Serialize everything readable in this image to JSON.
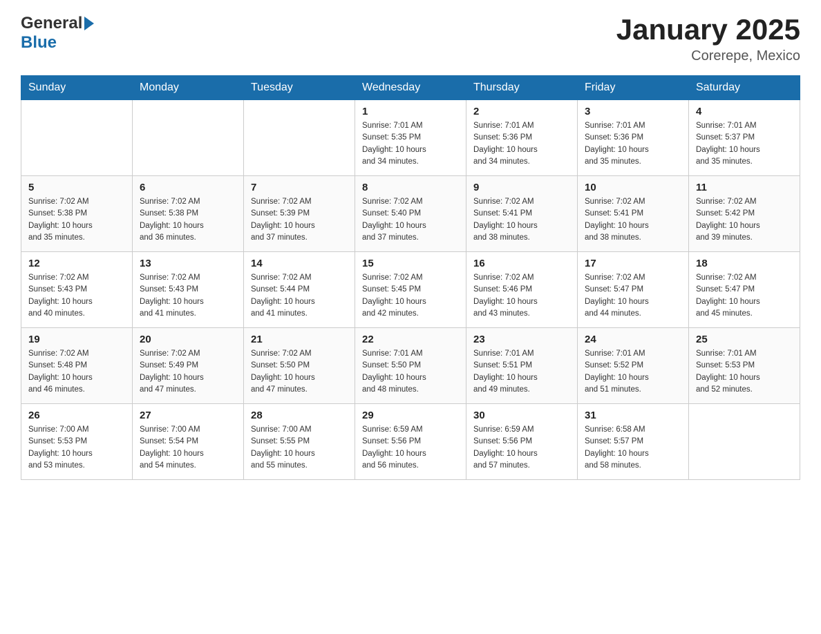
{
  "header": {
    "title": "January 2025",
    "subtitle": "Corerepe, Mexico",
    "logo_general": "General",
    "logo_blue": "Blue"
  },
  "days_of_week": [
    "Sunday",
    "Monday",
    "Tuesday",
    "Wednesday",
    "Thursday",
    "Friday",
    "Saturday"
  ],
  "weeks": [
    [
      {
        "day": "",
        "info": ""
      },
      {
        "day": "",
        "info": ""
      },
      {
        "day": "",
        "info": ""
      },
      {
        "day": "1",
        "info": "Sunrise: 7:01 AM\nSunset: 5:35 PM\nDaylight: 10 hours\nand 34 minutes."
      },
      {
        "day": "2",
        "info": "Sunrise: 7:01 AM\nSunset: 5:36 PM\nDaylight: 10 hours\nand 34 minutes."
      },
      {
        "day": "3",
        "info": "Sunrise: 7:01 AM\nSunset: 5:36 PM\nDaylight: 10 hours\nand 35 minutes."
      },
      {
        "day": "4",
        "info": "Sunrise: 7:01 AM\nSunset: 5:37 PM\nDaylight: 10 hours\nand 35 minutes."
      }
    ],
    [
      {
        "day": "5",
        "info": "Sunrise: 7:02 AM\nSunset: 5:38 PM\nDaylight: 10 hours\nand 35 minutes."
      },
      {
        "day": "6",
        "info": "Sunrise: 7:02 AM\nSunset: 5:38 PM\nDaylight: 10 hours\nand 36 minutes."
      },
      {
        "day": "7",
        "info": "Sunrise: 7:02 AM\nSunset: 5:39 PM\nDaylight: 10 hours\nand 37 minutes."
      },
      {
        "day": "8",
        "info": "Sunrise: 7:02 AM\nSunset: 5:40 PM\nDaylight: 10 hours\nand 37 minutes."
      },
      {
        "day": "9",
        "info": "Sunrise: 7:02 AM\nSunset: 5:41 PM\nDaylight: 10 hours\nand 38 minutes."
      },
      {
        "day": "10",
        "info": "Sunrise: 7:02 AM\nSunset: 5:41 PM\nDaylight: 10 hours\nand 38 minutes."
      },
      {
        "day": "11",
        "info": "Sunrise: 7:02 AM\nSunset: 5:42 PM\nDaylight: 10 hours\nand 39 minutes."
      }
    ],
    [
      {
        "day": "12",
        "info": "Sunrise: 7:02 AM\nSunset: 5:43 PM\nDaylight: 10 hours\nand 40 minutes."
      },
      {
        "day": "13",
        "info": "Sunrise: 7:02 AM\nSunset: 5:43 PM\nDaylight: 10 hours\nand 41 minutes."
      },
      {
        "day": "14",
        "info": "Sunrise: 7:02 AM\nSunset: 5:44 PM\nDaylight: 10 hours\nand 41 minutes."
      },
      {
        "day": "15",
        "info": "Sunrise: 7:02 AM\nSunset: 5:45 PM\nDaylight: 10 hours\nand 42 minutes."
      },
      {
        "day": "16",
        "info": "Sunrise: 7:02 AM\nSunset: 5:46 PM\nDaylight: 10 hours\nand 43 minutes."
      },
      {
        "day": "17",
        "info": "Sunrise: 7:02 AM\nSunset: 5:47 PM\nDaylight: 10 hours\nand 44 minutes."
      },
      {
        "day": "18",
        "info": "Sunrise: 7:02 AM\nSunset: 5:47 PM\nDaylight: 10 hours\nand 45 minutes."
      }
    ],
    [
      {
        "day": "19",
        "info": "Sunrise: 7:02 AM\nSunset: 5:48 PM\nDaylight: 10 hours\nand 46 minutes."
      },
      {
        "day": "20",
        "info": "Sunrise: 7:02 AM\nSunset: 5:49 PM\nDaylight: 10 hours\nand 47 minutes."
      },
      {
        "day": "21",
        "info": "Sunrise: 7:02 AM\nSunset: 5:50 PM\nDaylight: 10 hours\nand 47 minutes."
      },
      {
        "day": "22",
        "info": "Sunrise: 7:01 AM\nSunset: 5:50 PM\nDaylight: 10 hours\nand 48 minutes."
      },
      {
        "day": "23",
        "info": "Sunrise: 7:01 AM\nSunset: 5:51 PM\nDaylight: 10 hours\nand 49 minutes."
      },
      {
        "day": "24",
        "info": "Sunrise: 7:01 AM\nSunset: 5:52 PM\nDaylight: 10 hours\nand 51 minutes."
      },
      {
        "day": "25",
        "info": "Sunrise: 7:01 AM\nSunset: 5:53 PM\nDaylight: 10 hours\nand 52 minutes."
      }
    ],
    [
      {
        "day": "26",
        "info": "Sunrise: 7:00 AM\nSunset: 5:53 PM\nDaylight: 10 hours\nand 53 minutes."
      },
      {
        "day": "27",
        "info": "Sunrise: 7:00 AM\nSunset: 5:54 PM\nDaylight: 10 hours\nand 54 minutes."
      },
      {
        "day": "28",
        "info": "Sunrise: 7:00 AM\nSunset: 5:55 PM\nDaylight: 10 hours\nand 55 minutes."
      },
      {
        "day": "29",
        "info": "Sunrise: 6:59 AM\nSunset: 5:56 PM\nDaylight: 10 hours\nand 56 minutes."
      },
      {
        "day": "30",
        "info": "Sunrise: 6:59 AM\nSunset: 5:56 PM\nDaylight: 10 hours\nand 57 minutes."
      },
      {
        "day": "31",
        "info": "Sunrise: 6:58 AM\nSunset: 5:57 PM\nDaylight: 10 hours\nand 58 minutes."
      },
      {
        "day": "",
        "info": ""
      }
    ]
  ]
}
